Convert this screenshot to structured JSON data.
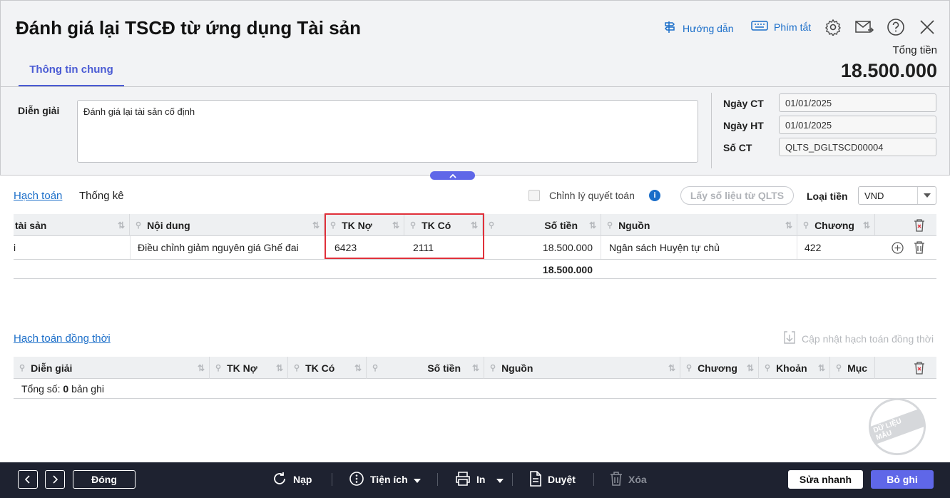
{
  "header": {
    "title": "Đánh giá lại TSCĐ từ ứng dụng Tài sản",
    "guide_label": "Hướng dẫn",
    "shortcut_label": "Phím tắt",
    "total_label": "Tổng tiền",
    "total_value": "18.500.000"
  },
  "tabs": [
    {
      "label": "Thông tin chung"
    }
  ],
  "form": {
    "description_label": "Diễn giải",
    "description_value": "Đánh giá lại tài sản cố định",
    "date_ct_label": "Ngày CT",
    "date_ct_value": "01/01/2025",
    "date_ht_label": "Ngày HT",
    "date_ht_value": "01/01/2025",
    "doc_no_label": "Số CT",
    "doc_no_value": "QLTS_DGLTSCD00004"
  },
  "section_tabs": {
    "accounting": "Hạch toán",
    "statistics": "Thống kê"
  },
  "options": {
    "settlement_label": "Chỉnh lý quyết toán",
    "fetch_button": "Lấy số liệu từ QLTS",
    "currency_label": "Loại tiền",
    "currency_value": "VND"
  },
  "grid1": {
    "headers": [
      "tài sản",
      "Nội dung",
      "TK Nợ",
      "TK Có",
      "Số tiền",
      "Nguồn",
      "Chương"
    ],
    "row": {
      "asset": "i",
      "content": "Điều chỉnh giảm nguyên giá Ghế đai",
      "debit": "6423",
      "credit": "2111",
      "amount": "18.500.000",
      "source": "Ngân sách Huyện tự chủ",
      "chapter": "422"
    },
    "total": "18.500.000"
  },
  "grid2": {
    "title": "Hạch toán đồng thời",
    "update_label": "Cập nhật hạch toán đồng thời",
    "headers": [
      "Diễn giải",
      "TK Nợ",
      "TK Có",
      "Số tiền",
      "Nguồn",
      "Chương",
      "Khoản",
      "Mục"
    ],
    "count_prefix": "Tổng số:",
    "count_value": "0",
    "count_suffix": "bản ghi"
  },
  "stamp_text": "DỮ LIỆU MẪU",
  "footer": {
    "close": "Đóng",
    "reload": "Nạp",
    "utilities": "Tiện ích",
    "print": "In",
    "approve": "Duyệt",
    "delete": "Xóa",
    "quick_edit": "Sửa nhanh",
    "unpost": "Bỏ ghi"
  }
}
